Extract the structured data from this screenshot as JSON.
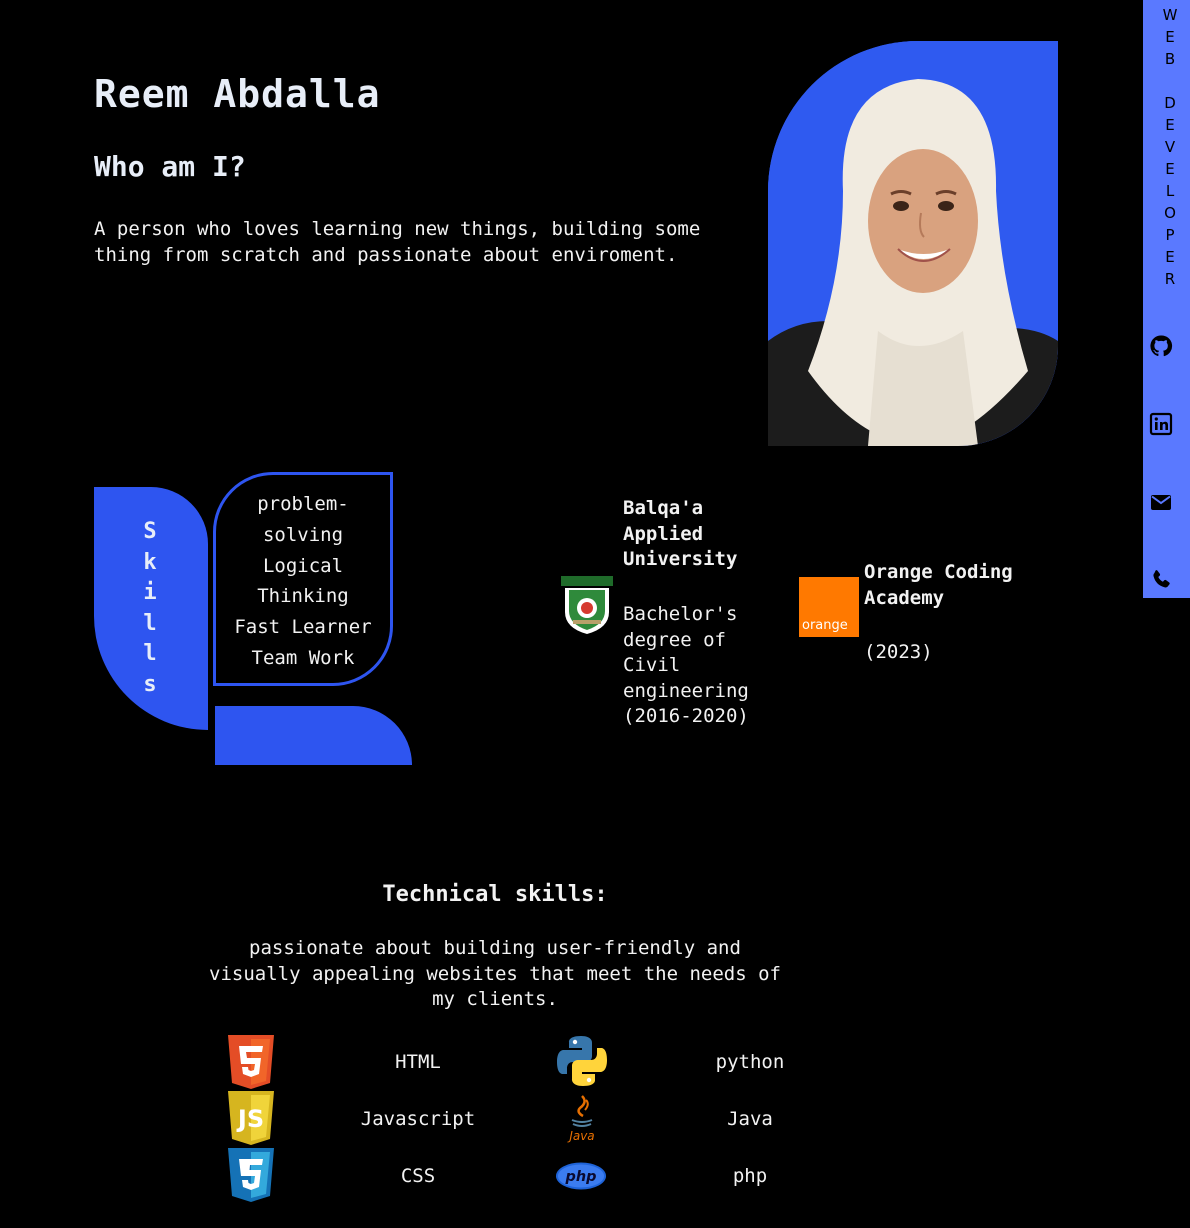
{
  "header": {
    "name": "Reem Abdalla",
    "who_title": "Who am I?",
    "intro": "A person who loves learning new things, building some thing from scratch and passionate about enviroment."
  },
  "sidebar": {
    "title_letters": [
      "W",
      "E",
      "B",
      " ",
      "D",
      "E",
      "V",
      "E",
      "L",
      "O",
      "P",
      "E",
      "R"
    ],
    "icons": [
      "github-icon",
      "linkedin-icon",
      "envelope-icon",
      "phone-icon"
    ]
  },
  "skills": {
    "tab_letters": [
      "S",
      "k",
      "i",
      "l",
      "l",
      "s"
    ],
    "soft": [
      "problem-",
      "solving",
      "Logical",
      "Thinking",
      "Fast Learner",
      "Team Work"
    ]
  },
  "education": [
    {
      "name": "Balqa'a Applied University",
      "degree": "Bachelor's degree of Civil engineering (2016-2020)"
    },
    {
      "name": "Orange Coding Academy",
      "year": "(2023)",
      "logo_text": "orange"
    }
  ],
  "technical": {
    "title": "Technical skills:",
    "description": "passionate about building user-friendly and visually appealing websites that meet the needs of my clients.",
    "items": [
      {
        "label": "HTML",
        "icon": "html5-icon"
      },
      {
        "label": "python",
        "icon": "python-icon"
      },
      {
        "label": "Javascript",
        "icon": "js-icon"
      },
      {
        "label": "Java",
        "icon": "java-icon",
        "icon_text": "Java"
      },
      {
        "label": "CSS",
        "icon": "css3-icon"
      },
      {
        "label": "php",
        "icon": "php-icon",
        "icon_text": "php"
      }
    ]
  },
  "colors": {
    "accent": "#2e55f0",
    "sidebar": "#5a79ff",
    "orange": "#ff7900"
  }
}
